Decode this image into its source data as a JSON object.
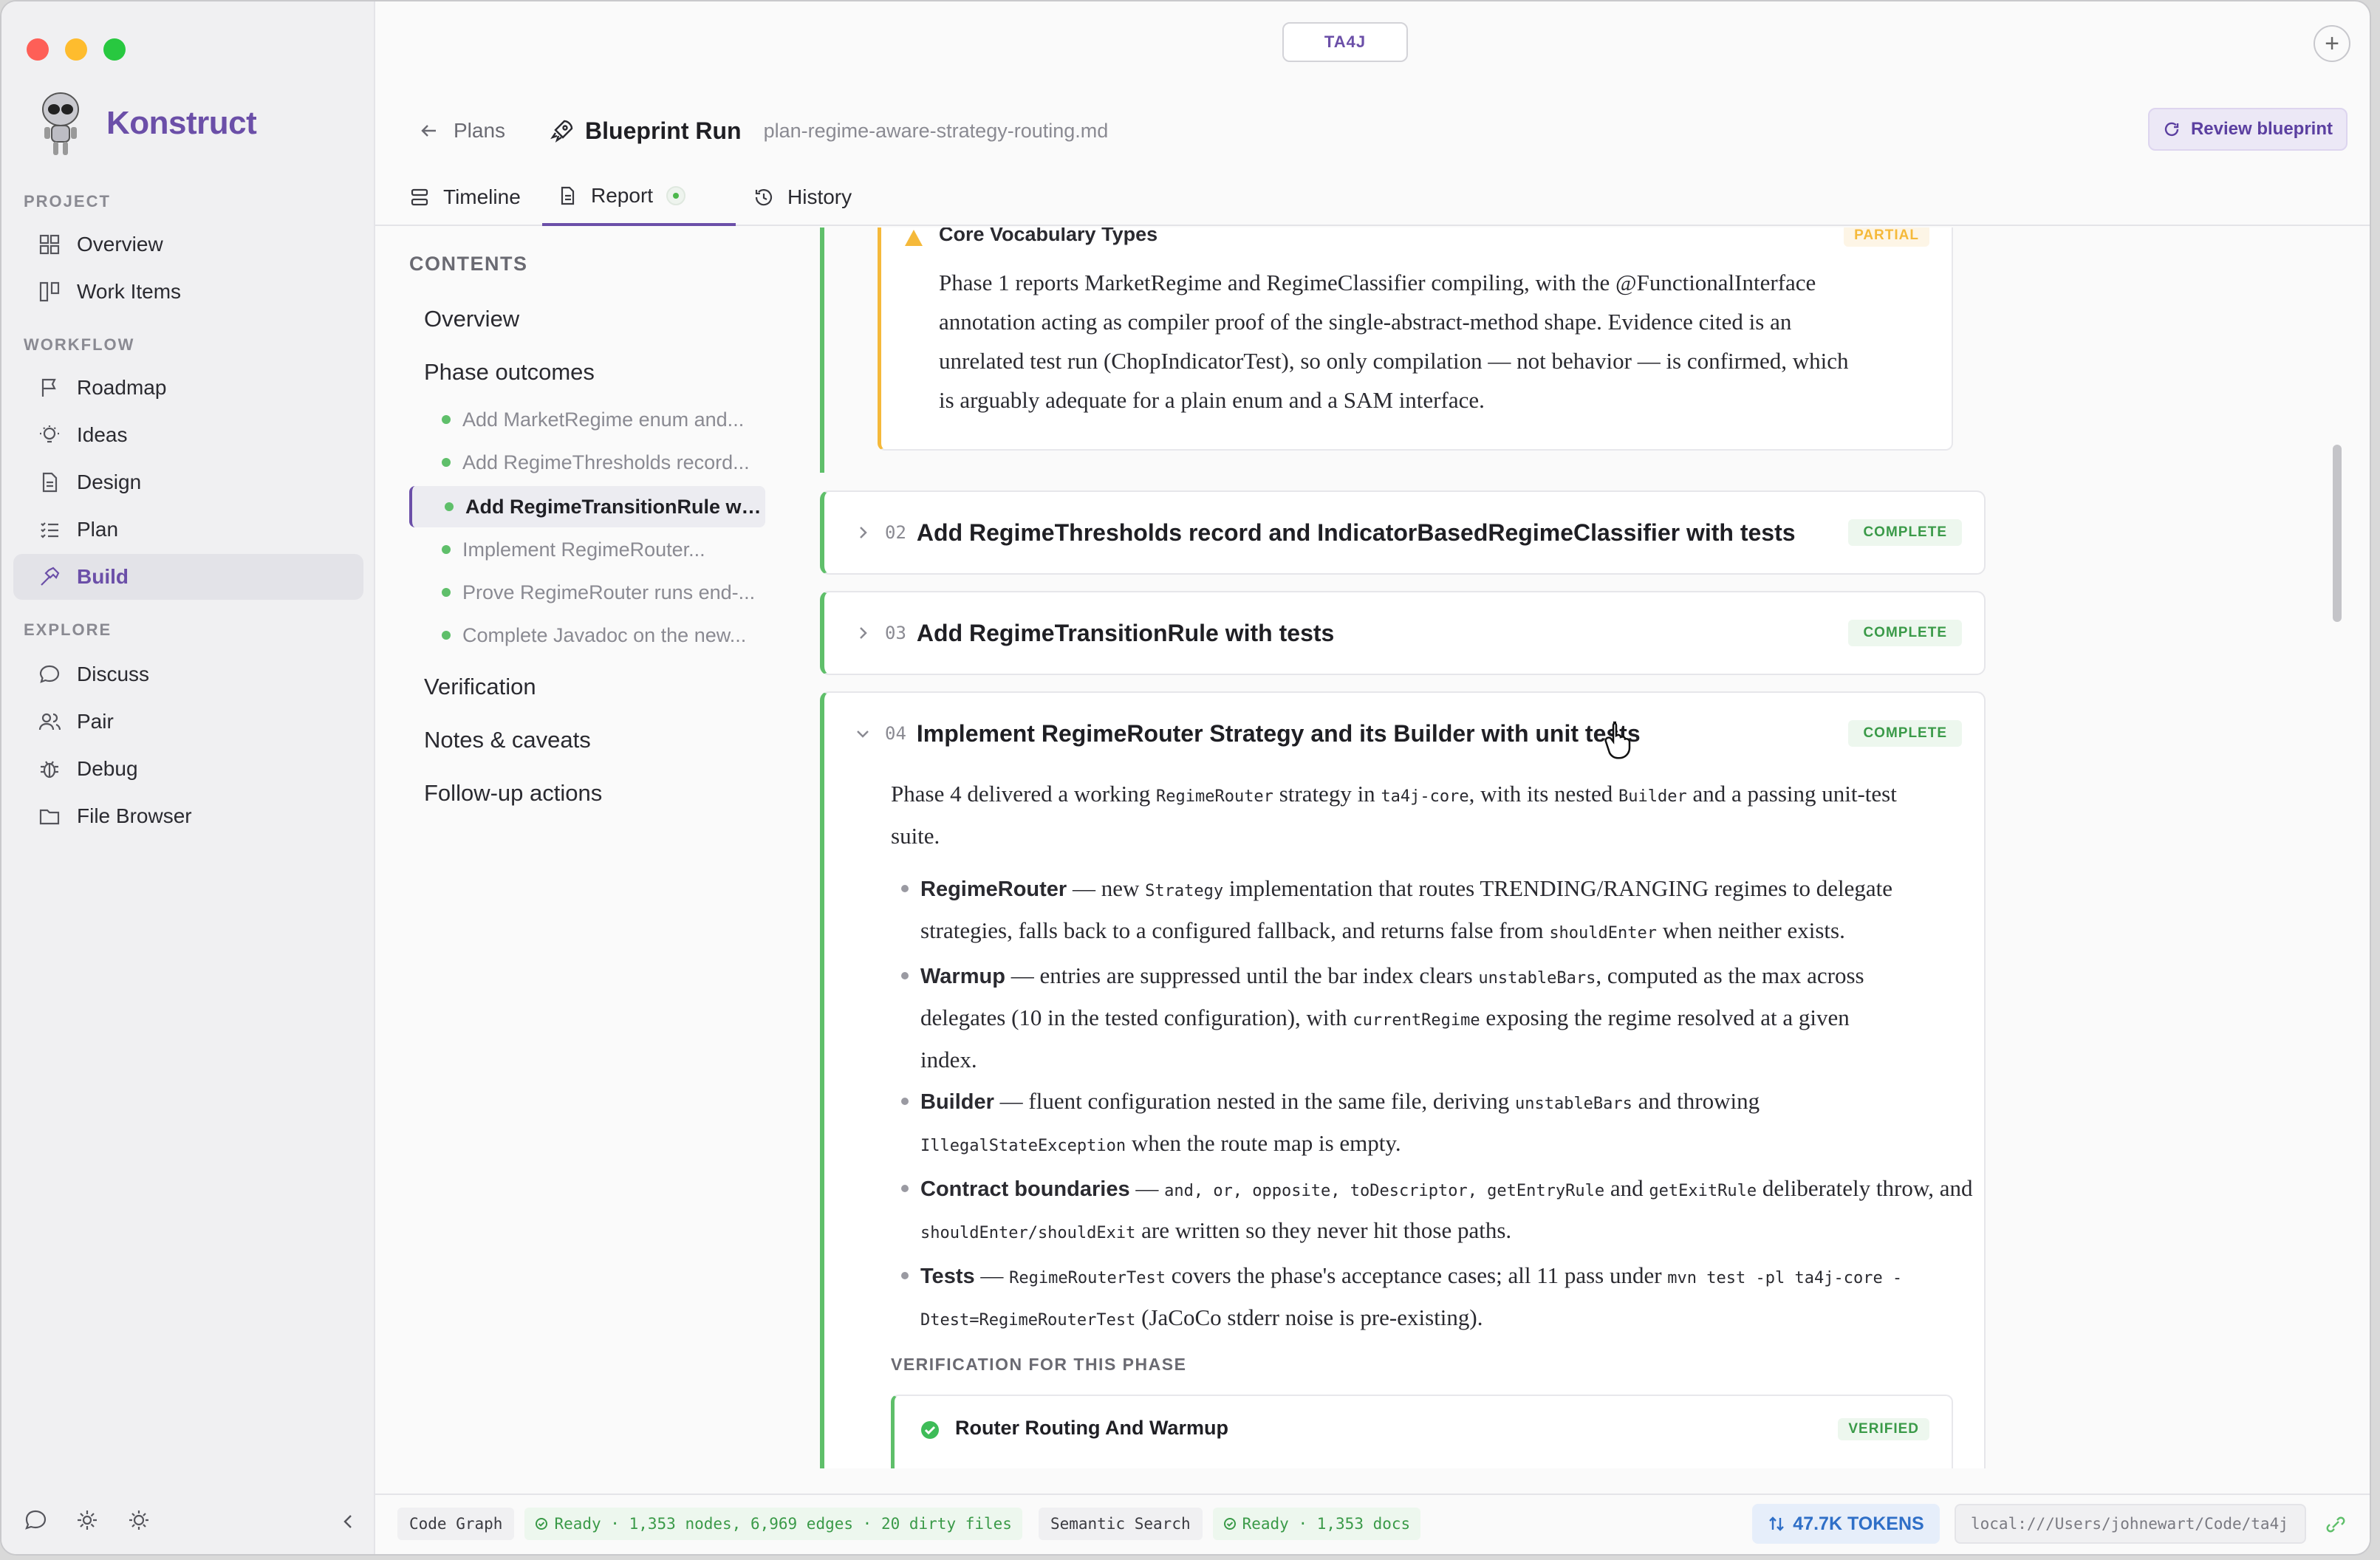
{
  "app": {
    "name": "Konstruct",
    "project_chip": "TA4J"
  },
  "sidebar": {
    "sections": [
      {
        "label": "PROJECT",
        "items": [
          {
            "label": "Overview",
            "icon": "grid-icon"
          },
          {
            "label": "Work Items",
            "icon": "kanban-icon"
          }
        ]
      },
      {
        "label": "WORKFLOW",
        "items": [
          {
            "label": "Roadmap",
            "icon": "flag-icon"
          },
          {
            "label": "Ideas",
            "icon": "lightbulb-icon"
          },
          {
            "label": "Design",
            "icon": "document-icon"
          },
          {
            "label": "Plan",
            "icon": "checklist-icon"
          },
          {
            "label": "Build",
            "icon": "hammer-icon",
            "active": true
          }
        ]
      },
      {
        "label": "EXPLORE",
        "items": [
          {
            "label": "Discuss",
            "icon": "chat-bubble-icon"
          },
          {
            "label": "Pair",
            "icon": "users-icon"
          },
          {
            "label": "Debug",
            "icon": "bug-icon"
          },
          {
            "label": "File Browser",
            "icon": "folder-icon"
          }
        ]
      }
    ]
  },
  "header": {
    "back_label": "Plans",
    "title": "Blueprint Run",
    "file": "plan-regime-aware-strategy-routing.md",
    "review_button": "Review blueprint"
  },
  "tabs": [
    {
      "label": "Timeline"
    },
    {
      "label": "Report",
      "active": true
    },
    {
      "label": "History"
    }
  ],
  "contents": {
    "heading": "CONTENTS",
    "items": [
      "Overview",
      "Phase outcomes",
      "Verification",
      "Notes & caveats",
      "Follow-up actions"
    ],
    "phases": [
      "Add MarketRegime enum and...",
      "Add RegimeThresholds record...",
      "Add RegimeTransitionRule wit...",
      "Implement RegimeRouter...",
      "Prove RegimeRouter runs end-...",
      "Complete Javadoc on the new..."
    ]
  },
  "report": {
    "partial_card": {
      "title": "Core Vocabulary Types",
      "badge": "PARTIAL",
      "lines": [
        "Phase 1 reports MarketRegime and RegimeClassifier compiling, with the @FunctionalInterface",
        "annotation acting as compiler proof of the single-abstract-method shape. Evidence cited is an",
        "unrelated test run (ChopIndicatorTest), so only compilation — not behavior — is confirmed, which",
        "is arguably adequate for a plain enum and a SAM interface."
      ]
    },
    "phases": [
      {
        "num": "02",
        "title": "Add RegimeThresholds record and IndicatorBasedRegimeClassifier with tests",
        "status": "COMPLETE"
      },
      {
        "num": "03",
        "title": "Add RegimeTransitionRule with tests",
        "status": "COMPLETE"
      },
      {
        "num": "04",
        "title": "Implement RegimeRouter Strategy and its Builder with unit tests",
        "status": "COMPLETE"
      }
    ],
    "phase4": {
      "intro_a": "Phase 4 delivered a working ",
      "intro_code1": "RegimeRouter",
      "intro_b": " strategy in ",
      "intro_code2": "ta4j-core",
      "intro_c": ", with its nested ",
      "intro_code3": "Builder",
      "intro_d": " and a passing unit-test",
      "intro_e": "suite.",
      "b1_term": "RegimeRouter",
      "b1_a": " — new ",
      "b1_code": "Strategy",
      "b1_b": " implementation that routes TRENDING/RANGING regimes to delegate",
      "b1_c": "strategies, falls back to a configured fallback, and returns false from ",
      "b1_code2": "shouldEnter",
      "b1_d": " when neither exists.",
      "b2_term": "Warmup",
      "b2_a": " — entries are suppressed until the bar index clears ",
      "b2_code": "unstableBars",
      "b2_b": ", computed as the max across",
      "b2_c": "delegates (10 in the tested configuration), with ",
      "b2_code2": "currentRegime",
      "b2_d": " exposing the regime resolved at a given",
      "b2_e": "index.",
      "b3_term": "Builder",
      "b3_a": " — fluent configuration nested in the same file, deriving ",
      "b3_code": "unstableBars",
      "b3_b": " and throwing",
      "b3_code2": "IllegalStateException",
      "b3_c": " when the route map is empty.",
      "b4_term": "Contract boundaries",
      "b4_a": " — ",
      "b4_code": "and, or, opposite, toDescriptor, getEntryRule",
      "b4_b": " and ",
      "b4_code2": "getExitRule",
      "b4_c": " deliberately throw, and",
      "b4_code3": "shouldEnter/shouldExit",
      "b4_d": " are written so they never hit those paths.",
      "b5_term": "Tests",
      "b5_a": " — ",
      "b5_code": "RegimeRouterTest",
      "b5_b": " covers the phase's acceptance cases; all 11 pass under ",
      "b5_code2": "mvn test -pl ta4j-core -",
      "b5_code3": "Dtest=RegimeRouterTest",
      "b5_c": " (JaCoCo stderr noise is pre-existing).",
      "verif_heading": "VERIFICATION FOR THIS PHASE",
      "verif_title": "Router Routing And Warmup",
      "verif_badge": "VERIFIED"
    }
  },
  "statusbar": {
    "code_graph_label": "Code Graph",
    "code_graph_status": "Ready · 1,353 nodes, 6,969 edges · 20 dirty files",
    "semantic_label": "Semantic Search",
    "semantic_status": "Ready · 1,353 docs",
    "tokens": "47.7K TOKENS",
    "path": "local:///Users/johnewart/Code/ta4j"
  },
  "colors": {
    "accent": "#6b4fa8",
    "complete": "#3a9a48",
    "partial": "#f5b93a",
    "tokens": "#2f6fc7"
  }
}
